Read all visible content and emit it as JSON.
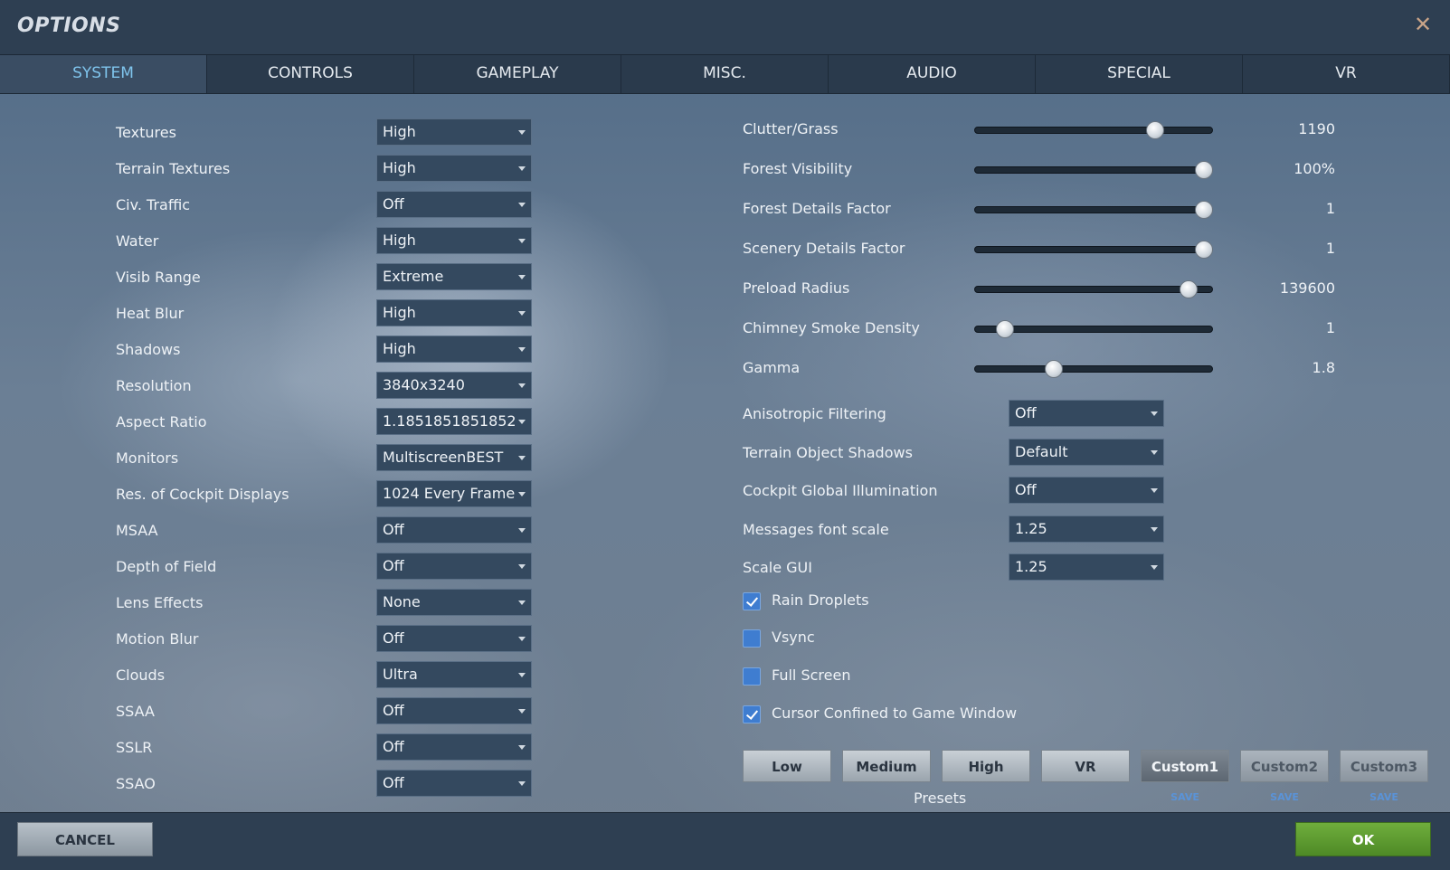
{
  "window": {
    "title": "OPTIONS",
    "close_label": "✕"
  },
  "tabs": [
    {
      "label": "SYSTEM",
      "active": true
    },
    {
      "label": "CONTROLS"
    },
    {
      "label": "GAMEPLAY"
    },
    {
      "label": "MISC."
    },
    {
      "label": "AUDIO"
    },
    {
      "label": "SPECIAL"
    },
    {
      "label": "VR"
    }
  ],
  "left_settings": [
    {
      "label": "Textures",
      "value": "High"
    },
    {
      "label": "Terrain Textures",
      "value": "High"
    },
    {
      "label": "Civ. Traffic",
      "value": "Off"
    },
    {
      "label": "Water",
      "value": "High"
    },
    {
      "label": "Visib Range",
      "value": "Extreme"
    },
    {
      "label": "Heat Blur",
      "value": "High"
    },
    {
      "label": "Shadows",
      "value": "High"
    },
    {
      "label": "Resolution",
      "value": "3840x3240"
    },
    {
      "label": "Aspect Ratio",
      "value": "1.1851851851852"
    },
    {
      "label": "Monitors",
      "value": "MultiscreenBEST"
    },
    {
      "label": "Res. of Cockpit Displays",
      "value": "1024 Every Frame"
    },
    {
      "label": "MSAA",
      "value": "Off"
    },
    {
      "label": "Depth of Field",
      "value": "Off"
    },
    {
      "label": "Lens Effects",
      "value": "None"
    },
    {
      "label": "Motion Blur",
      "value": "Off"
    },
    {
      "label": "Clouds",
      "value": "Ultra"
    },
    {
      "label": "SSAA",
      "value": "Off"
    },
    {
      "label": "SSLR",
      "value": "Off"
    },
    {
      "label": "SSAO",
      "value": "Off"
    }
  ],
  "sliders": [
    {
      "label": "Clutter/Grass",
      "value": "1190",
      "level": 0.78
    },
    {
      "label": "Forest Visibility",
      "value": "100%",
      "level": 1.0
    },
    {
      "label": "Forest Details Factor",
      "value": "1",
      "level": 1.0
    },
    {
      "label": "Scenery Details Factor",
      "value": "1",
      "level": 1.0
    },
    {
      "label": "Preload Radius",
      "value": "139600",
      "level": 0.93
    },
    {
      "label": "Chimney Smoke Density",
      "value": "1",
      "level": 0.1
    },
    {
      "label": "Gamma",
      "value": "1.8",
      "level": 0.32
    }
  ],
  "right_settings": [
    {
      "label": "Anisotropic Filtering",
      "value": "Off"
    },
    {
      "label": "Terrain Object Shadows",
      "value": "Default"
    },
    {
      "label": "Cockpit Global Illumination",
      "value": "Off"
    },
    {
      "label": "Messages font scale",
      "value": "1.25"
    },
    {
      "label": "Scale GUI",
      "value": "1.25"
    }
  ],
  "checkboxes": [
    {
      "label": "Rain Droplets",
      "checked": true
    },
    {
      "label": "Vsync",
      "checked": false
    },
    {
      "label": "Full Screen",
      "checked": false
    },
    {
      "label": "Cursor Confined to Game Window",
      "checked": true
    }
  ],
  "presets": {
    "label": "Presets",
    "buttons": [
      "Low",
      "Medium",
      "High",
      "VR",
      "Custom1",
      "Custom2",
      "Custom3"
    ],
    "save_label": "SAVE"
  },
  "footer": {
    "cancel_label": "CANCEL",
    "ok_label": "OK"
  },
  "colors": {
    "accent_tab": "#7fc4ec",
    "ok_green": "#5a9a2e",
    "checkbox_blue": "#3f7dd0"
  }
}
